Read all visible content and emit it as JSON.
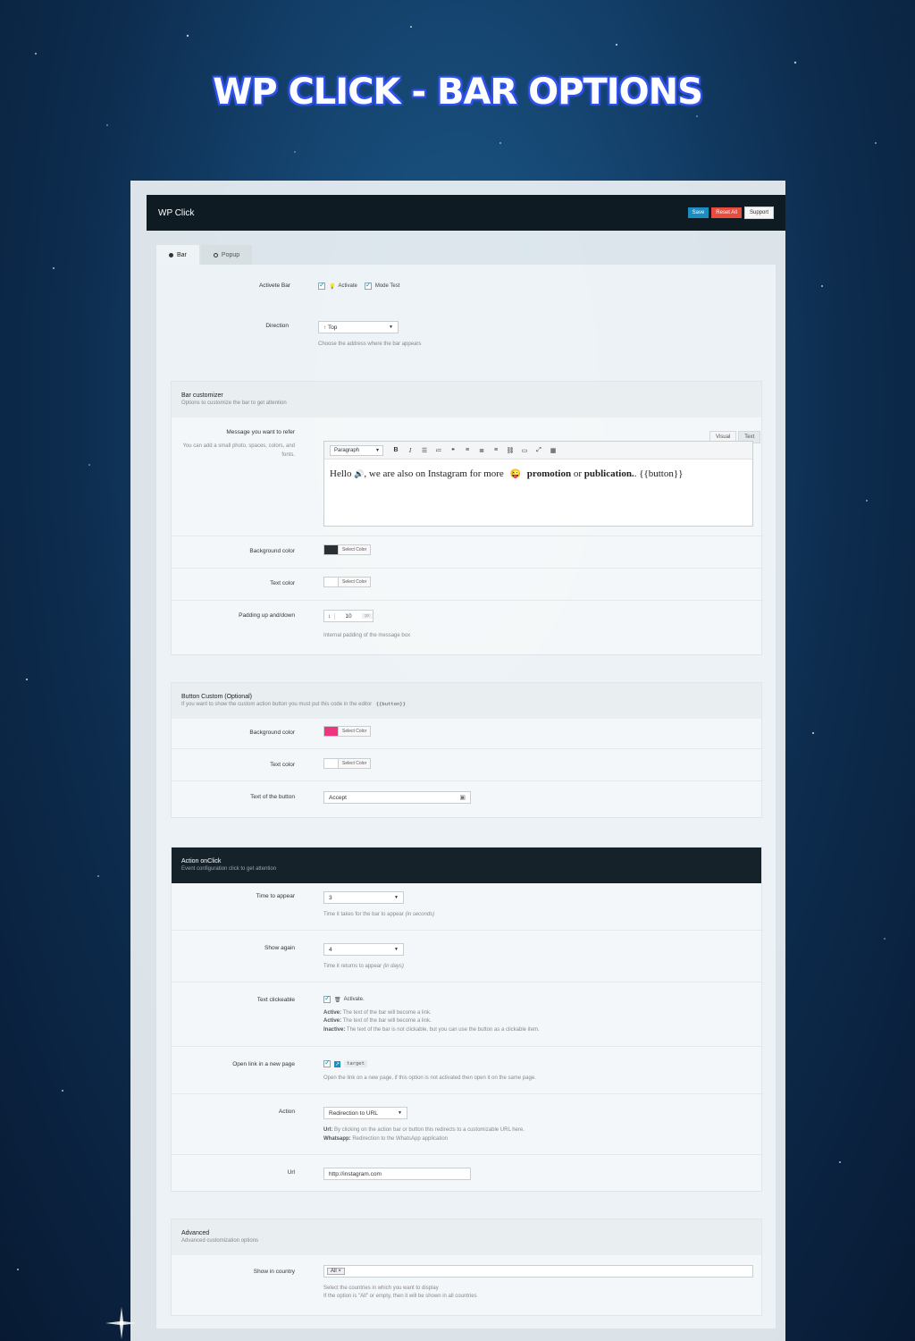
{
  "hero": {
    "title": "WP CLICK - BAR OPTIONS"
  },
  "header": {
    "app_title": "WP Click",
    "save": "Save",
    "reset": "Reset All",
    "support": "Support"
  },
  "tabs": [
    {
      "label": "Bar"
    },
    {
      "label": "Popup"
    }
  ],
  "general": {
    "activate_bar_label": "Activete Bar",
    "activate_label": "Activate",
    "mode_test_label": "Mode Test",
    "direction_label": "Direction",
    "direction_value": "↑ Top",
    "direction_hint": "Choose the address where the bar appears"
  },
  "bar_customizer": {
    "title": "Bar customizer",
    "subtitle": "Options to customize the bar to get attention",
    "message_label": "Message you want to refer",
    "message_hint": "You can add a small photo, spaces, colors, and fonts.",
    "editor_tabs": [
      "Visual",
      "Text"
    ],
    "paragraph": "Paragraph",
    "msg_part1": "Hello",
    "msg_part2": ", we are also on Instagram for more",
    "msg_bold1": "promotion",
    "msg_part3": "or",
    "msg_bold2": "publication.",
    "msg_part4": ". {{button}}",
    "bg_color_label": "Background color",
    "bg_color": "#2a2f33",
    "text_color_label": "Text color",
    "text_color": "#ffffff",
    "select_color": "Select Color",
    "padding_label": "Padding up and/down",
    "padding_value": "10",
    "padding_unit": "px",
    "padding_hint": "Internal padding of the message box"
  },
  "button_custom": {
    "title": "Button Custom (Optional)",
    "subtitle": "If you want to show the custom action button you must put this code in the editor",
    "code": "{{button}}",
    "bg_color_label": "Background color",
    "bg_color": "#f0357e",
    "text_color_label": "Text color",
    "text_color": "#ffffff",
    "select_color": "Select Color",
    "text_label": "Text of the button",
    "text_value": "Accept"
  },
  "action": {
    "title": "Action onClick",
    "subtitle": "Event configuration click to get attention",
    "time_label": "Time to appear",
    "time_value": "3",
    "time_hint": "Time it takes for the bar to appear",
    "time_hint_unit": "(in seconds)",
    "show_label": "Show again",
    "show_value": "4",
    "show_hint": "Time it returns to appear",
    "show_hint_unit": "(in days)",
    "clickable_label": "Text clickeable",
    "clickable_activate": "Activate.",
    "clickable_hint1_b": "Active:",
    "clickable_hint1": "The text of the bar will become a link.",
    "clickable_hint2_b": "Active:",
    "clickable_hint2": "The text of the bar will become a link.",
    "clickable_hint3_b": "Inactive:",
    "clickable_hint3": "The text of the bar is not clickable, but you can use the button as a clickable item.",
    "newpage_label": "Open link in a new page",
    "newpage_code": "target",
    "newpage_hint": "Open the link on a new page, if this option is not activated then open it on the same page.",
    "action_label": "Action",
    "action_value": "Redirection to URL",
    "action_hint1_b": "Url:",
    "action_hint1": "By clicking on the action bar or button this redirects to a customizable URL here.",
    "action_hint2_b": "Whatsapp:",
    "action_hint2": "Redirection to the WhatsApp application",
    "url_label": "Url",
    "url_value": "http://instagram.com"
  },
  "advanced": {
    "title": "Advanced",
    "subtitle": "Advanced customization options",
    "country_label": "Show in country",
    "country_tag": "All ×",
    "country_hint1": "Select the countries in which you want to display",
    "country_hint2": "If the option is \"All\" or empty, then it will be shown in all countries"
  }
}
